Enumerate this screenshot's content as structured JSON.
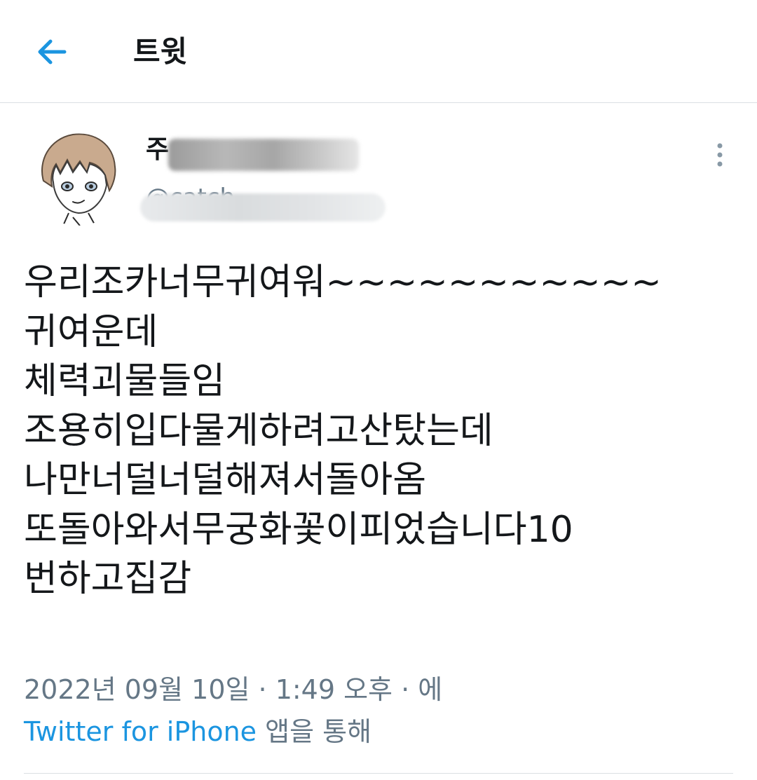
{
  "header": {
    "back_icon": "arrow-left-icon",
    "title": "트윗",
    "accent_color": "#1b95e0"
  },
  "tweet": {
    "author": {
      "display_name": "주",
      "handle": "@catch",
      "avatar_icon": "anime-avatar"
    },
    "more_icon": "vertical-ellipsis-icon",
    "lines": [
      "우리조카너무귀여워~~~~~~~~~~~",
      "귀여운데",
      "체력괴물들임",
      "조용히입다물게하려고산탔는데",
      "나만너덜너덜해져서돌아옴",
      "또돌아와서무궁화꽃이피었습니다10",
      "번하고집감"
    ],
    "meta": "2022년 09월 10일 · 1:49 오후 · 에",
    "source_link": "Twitter for iPhone",
    "source_suffix": " 앱을 통해"
  }
}
